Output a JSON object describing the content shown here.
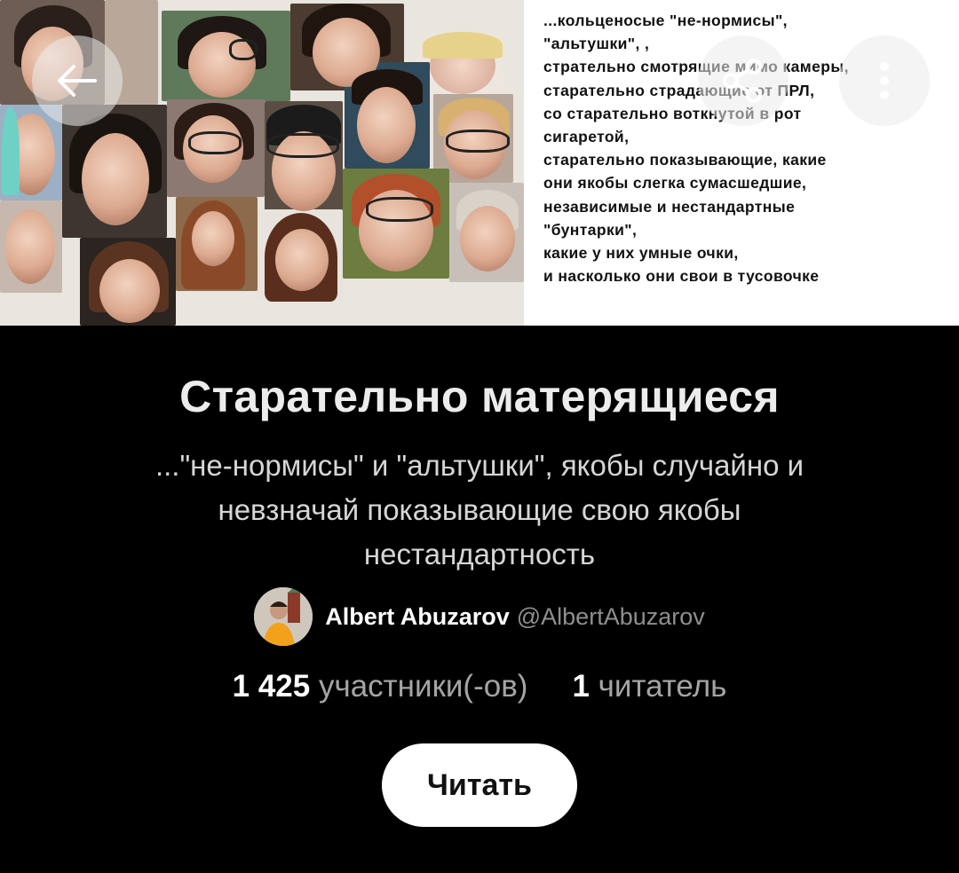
{
  "banner": {
    "caption_lines": [
      "...кольценосые \"не-нормисы\",",
      "\"альтушки\", ,",
      "стрательно смотрящие мимо камеры,",
      "старательно страдающие от ПРЛ,",
      "со старательно воткнутой в рот",
      "сигаретой,",
      "старательно показывающие, какие",
      "они якобы слегка сумасшедшие,",
      "независимые и нестандартные",
      "\"бунтарки\",",
      "какие у них умные очки,",
      "и насколько они свои в тусовочке"
    ]
  },
  "toolbar": {
    "back_icon": "arrow-left-icon",
    "share_icon": "share-icon",
    "more_icon": "more-vertical-icon"
  },
  "community": {
    "title": "Старательно матерящиеся",
    "description": "...\"не-нормисы\" и \"альтушки\", якобы случайно и невзначай показывающие свою якобы нестандартность",
    "author_name": "Albert Abuzarov",
    "author_handle": "@AlbertAbuzarov",
    "members_count": "1 425",
    "members_label": "участники(-ов)",
    "readers_count": "1",
    "readers_label": "читатель",
    "read_button": "Читать"
  },
  "colors": {
    "background": "#000000",
    "button_bg": "#ffffff",
    "title": "#ececec",
    "muted": "#a4a4a4"
  }
}
